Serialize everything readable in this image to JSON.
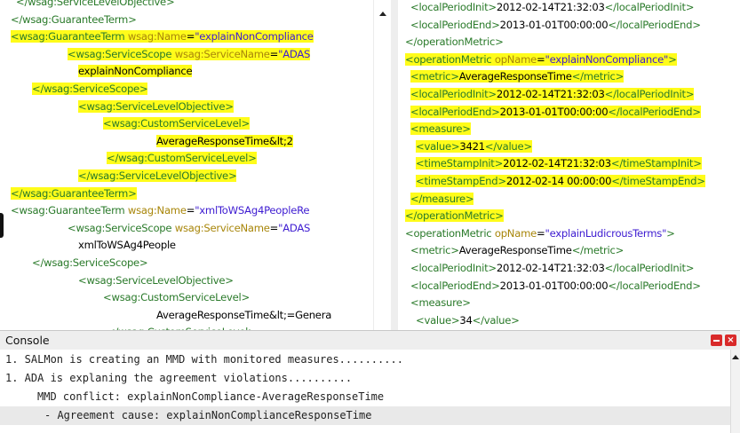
{
  "left_pane": [
    {
      "indent": 6,
      "hl": false,
      "segs": [
        {
          "c": "t",
          "t": "</wsag:ServiceLevelObjective>"
        }
      ]
    },
    {
      "indent": 0,
      "hl": false,
      "segs": [
        {
          "c": "t",
          "t": "</wsag:GuaranteeTerm>"
        }
      ]
    },
    {
      "indent": 0,
      "hl": true,
      "segs": [
        {
          "c": "t",
          "t": "<wsag:GuaranteeTerm "
        },
        {
          "c": "k",
          "t": "wsag:Name"
        },
        {
          "c": "x",
          "t": "="
        },
        {
          "c": "v",
          "t": "\"explainNonCompliance"
        }
      ]
    },
    {
      "indent": 64,
      "hl": true,
      "segs": [
        {
          "c": "t",
          "t": "<wsag:ServiceScope "
        },
        {
          "c": "k",
          "t": "wsag:ServiceName"
        },
        {
          "c": "x",
          "t": "="
        },
        {
          "c": "v",
          "t": "\"ADAS"
        }
      ]
    },
    {
      "indent": 76,
      "hl": true,
      "segs": [
        {
          "c": "x",
          "t": "explainNonCompliance"
        }
      ]
    },
    {
      "indent": 24,
      "hl": true,
      "segs": [
        {
          "c": "t",
          "t": "</wsag:ServiceScope>"
        }
      ]
    },
    {
      "indent": 76,
      "hl": true,
      "segs": [
        {
          "c": "t",
          "t": "<wsag:ServiceLevelObjective>"
        }
      ]
    },
    {
      "indent": 104,
      "hl": true,
      "segs": [
        {
          "c": "t",
          "t": "<wsag:CustomServiceLevel>"
        }
      ]
    },
    {
      "indent": 164,
      "hl": true,
      "segs": [
        {
          "c": "x",
          "t": "AverageResponseTime&lt;2"
        }
      ]
    },
    {
      "indent": 108,
      "hl": true,
      "segs": [
        {
          "c": "t",
          "t": "</wsag:CustomServiceLevel>"
        }
      ]
    },
    {
      "indent": 76,
      "hl": true,
      "segs": [
        {
          "c": "t",
          "t": "</wsag:ServiceLevelObjective>"
        }
      ]
    },
    {
      "indent": 0,
      "hl": true,
      "segs": [
        {
          "c": "t",
          "t": "</wsag:GuaranteeTerm>"
        }
      ]
    },
    {
      "indent": 0,
      "hl": false,
      "segs": [
        {
          "c": "t",
          "t": "<wsag:GuaranteeTerm "
        },
        {
          "c": "k",
          "t": "wsag:Name"
        },
        {
          "c": "x",
          "t": "="
        },
        {
          "c": "v",
          "t": "\"xmlToWSAg4PeopleRe"
        }
      ]
    },
    {
      "indent": 64,
      "hl": false,
      "segs": [
        {
          "c": "t",
          "t": "<wsag:ServiceScope "
        },
        {
          "c": "k",
          "t": "wsag:ServiceName"
        },
        {
          "c": "x",
          "t": "="
        },
        {
          "c": "v",
          "t": "\"ADAS"
        }
      ]
    },
    {
      "indent": 76,
      "hl": false,
      "segs": [
        {
          "c": "x",
          "t": "xmlToWSAg4People"
        }
      ]
    },
    {
      "indent": 24,
      "hl": false,
      "segs": [
        {
          "c": "t",
          "t": "</wsag:ServiceScope>"
        }
      ]
    },
    {
      "indent": 76,
      "hl": false,
      "segs": [
        {
          "c": "t",
          "t": "<wsag:ServiceLevelObjective>"
        }
      ]
    },
    {
      "indent": 104,
      "hl": false,
      "segs": [
        {
          "c": "t",
          "t": "<wsag:CustomServiceLevel>"
        }
      ]
    },
    {
      "indent": 164,
      "hl": false,
      "segs": [
        {
          "c": "x",
          "t": "AverageResponseTime&lt;=Genera"
        }
      ]
    },
    {
      "indent": 108,
      "hl": false,
      "segs": [
        {
          "c": "t",
          "t": "</wsag:CustomServiceLevel>"
        }
      ]
    }
  ],
  "right_pane": [
    {
      "indent": 14,
      "hl": false,
      "segs": [
        {
          "c": "t",
          "t": "<localPeriodInit>"
        },
        {
          "c": "x",
          "t": "2012-02-14T21:32:03"
        },
        {
          "c": "t",
          "t": "</localPeriodInit>"
        }
      ]
    },
    {
      "indent": 14,
      "hl": false,
      "segs": [
        {
          "c": "t",
          "t": "<localPeriodEnd>"
        },
        {
          "c": "x",
          "t": "2013-01-01T00:00:00"
        },
        {
          "c": "t",
          "t": "</localPeriodEnd>"
        }
      ]
    },
    {
      "indent": 8,
      "hl": false,
      "segs": [
        {
          "c": "t",
          "t": "</operationMetric>"
        }
      ]
    },
    {
      "indent": 8,
      "hl": true,
      "segs": [
        {
          "c": "t",
          "t": "<operationMetric "
        },
        {
          "c": "k",
          "t": "opName"
        },
        {
          "c": "x",
          "t": "="
        },
        {
          "c": "v",
          "t": "\"explainNonCompliance\""
        },
        {
          "c": "t",
          "t": ">"
        }
      ]
    },
    {
      "indent": 14,
      "hl": true,
      "segs": [
        {
          "c": "t",
          "t": "<metric>"
        },
        {
          "c": "x",
          "t": "AverageResponseTime"
        },
        {
          "c": "t",
          "t": "</metric>"
        }
      ]
    },
    {
      "indent": 14,
      "hl": true,
      "segs": [
        {
          "c": "t",
          "t": "<localPeriodInit>"
        },
        {
          "c": "x",
          "t": "2012-02-14T21:32:03"
        },
        {
          "c": "t",
          "t": "</localPeriodInit>"
        }
      ]
    },
    {
      "indent": 14,
      "hl": true,
      "segs": [
        {
          "c": "t",
          "t": "<localPeriodEnd>"
        },
        {
          "c": "x",
          "t": "2013-01-01T00:00:00"
        },
        {
          "c": "t",
          "t": "</localPeriodEnd>"
        }
      ]
    },
    {
      "indent": 14,
      "hl": true,
      "segs": [
        {
          "c": "t",
          "t": "<measure>"
        }
      ]
    },
    {
      "indent": 20,
      "hl": true,
      "segs": [
        {
          "c": "t",
          "t": "<value>"
        },
        {
          "c": "x",
          "t": "3421"
        },
        {
          "c": "t",
          "t": "</value>"
        }
      ]
    },
    {
      "indent": 20,
      "hl": true,
      "segs": [
        {
          "c": "t",
          "t": "<timeStampInit>"
        },
        {
          "c": "x",
          "t": "2012-02-14T21:32:03"
        },
        {
          "c": "t",
          "t": "</timeStampInit>"
        }
      ]
    },
    {
      "indent": 20,
      "hl": true,
      "segs": [
        {
          "c": "t",
          "t": "<timeStampEnd>"
        },
        {
          "c": "x",
          "t": "2012-02-14 00:00:00"
        },
        {
          "c": "t",
          "t": "</timeStampEnd>"
        }
      ]
    },
    {
      "indent": 14,
      "hl": true,
      "segs": [
        {
          "c": "t",
          "t": "</measure>"
        }
      ]
    },
    {
      "indent": 8,
      "hl": true,
      "segs": [
        {
          "c": "t",
          "t": "</operationMetric>"
        }
      ]
    },
    {
      "indent": 8,
      "hl": false,
      "segs": [
        {
          "c": "t",
          "t": "<operationMetric "
        },
        {
          "c": "k",
          "t": "opName"
        },
        {
          "c": "x",
          "t": "="
        },
        {
          "c": "v",
          "t": "\"explainLudicrousTerms\""
        },
        {
          "c": "t",
          "t": ">"
        }
      ]
    },
    {
      "indent": 14,
      "hl": false,
      "segs": [
        {
          "c": "t",
          "t": "<metric>"
        },
        {
          "c": "x",
          "t": "AverageResponseTime"
        },
        {
          "c": "t",
          "t": "</metric>"
        }
      ]
    },
    {
      "indent": 14,
      "hl": false,
      "segs": [
        {
          "c": "t",
          "t": "<localPeriodInit>"
        },
        {
          "c": "x",
          "t": "2012-02-14T21:32:03"
        },
        {
          "c": "t",
          "t": "</localPeriodInit>"
        }
      ]
    },
    {
      "indent": 14,
      "hl": false,
      "segs": [
        {
          "c": "t",
          "t": "<localPeriodEnd>"
        },
        {
          "c": "x",
          "t": "2013-01-01T00:00:00"
        },
        {
          "c": "t",
          "t": "</localPeriodEnd>"
        }
      ]
    },
    {
      "indent": 14,
      "hl": false,
      "segs": [
        {
          "c": "t",
          "t": "<measure>"
        }
      ]
    },
    {
      "indent": 20,
      "hl": false,
      "segs": [
        {
          "c": "t",
          "t": "<value>"
        },
        {
          "c": "x",
          "t": "34"
        },
        {
          "c": "t",
          "t": "</value>"
        }
      ]
    }
  ],
  "console": {
    "title": "Console",
    "close_glyph": "×",
    "lines": [
      {
        "text": "1. SALMon is creating an MMD with monitored measures..........",
        "selected": false,
        "indent": 0
      },
      {
        "text": "1. ADA is explaning the agreement violations..........",
        "selected": false,
        "indent": 0
      },
      {
        "text": "MMD conflict: explainNonCompliance-AverageResponseTime",
        "selected": false,
        "indent": 36
      },
      {
        "text": "- Agreement cause: explainNonComplianceResponseTime",
        "selected": true,
        "indent": 44
      }
    ]
  },
  "colors": {
    "highlight": "#fffc1a",
    "tag": "#2a7a2a",
    "attr": "#a8860a",
    "value": "#3d1bd1",
    "close_button": "#d92a2a"
  }
}
